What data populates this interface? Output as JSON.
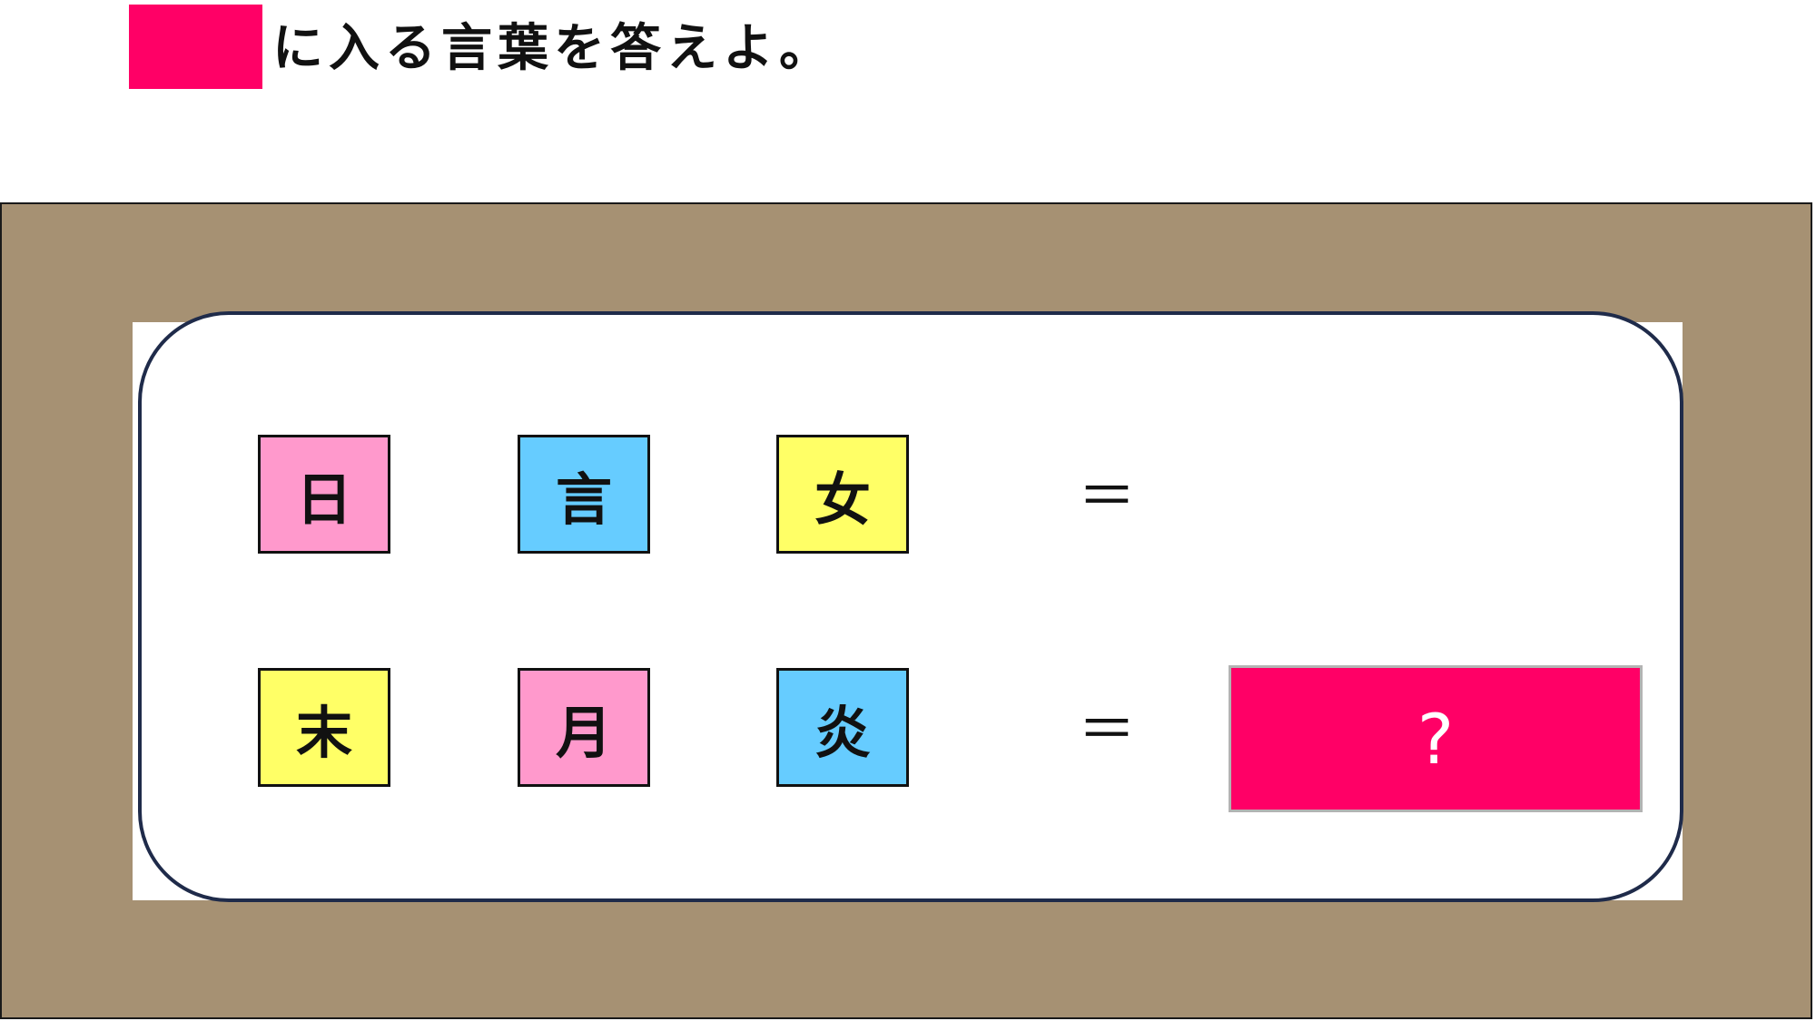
{
  "header": {
    "instruction": "に入る言葉を答えよ。",
    "answer_swatch_color": "#ff0066"
  },
  "puzzle": {
    "row1": {
      "tiles": [
        {
          "char": "日",
          "color": "#ff99cc"
        },
        {
          "char": "言",
          "color": "#66ccff"
        },
        {
          "char": "女",
          "color": "#ffff66"
        }
      ],
      "equals": "＝"
    },
    "row2": {
      "tiles": [
        {
          "char": "末",
          "color": "#ffff66"
        },
        {
          "char": "月",
          "color": "#ff99cc"
        },
        {
          "char": "炎",
          "color": "#66ccff"
        }
      ],
      "equals": "＝",
      "answer": "?"
    }
  },
  "colors": {
    "frame": "#a69173",
    "board_border": "#1f2b4a",
    "answer_fill": "#ff0066"
  }
}
